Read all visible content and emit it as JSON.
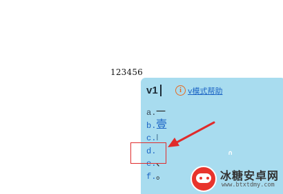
{
  "document": {
    "typed_text": "123456"
  },
  "ime": {
    "input_code": "v1",
    "help_icon_glyph": "i",
    "help_link": "v模式帮助",
    "candidates": [
      {
        "key": "a.",
        "text": "一",
        "state": "normal"
      },
      {
        "key": "b.",
        "text": "壹",
        "state": "active"
      },
      {
        "key": "c.",
        "text": "Ⅰ",
        "state": "faded"
      },
      {
        "key": "d.",
        "text": "",
        "state": "highlighted"
      },
      {
        "key": "e.",
        "text": "、",
        "state": "active"
      },
      {
        "key": "f.",
        "text": "。",
        "state": "active"
      }
    ],
    "panel_color": "#a8dcef",
    "link_color": "#1a63c4",
    "help_icon_color": "#e8671c"
  },
  "annotation": {
    "arrow_color": "#e02b2b",
    "box_color": "#e02b2b"
  },
  "watermark": {
    "title": "冰糖安卓网",
    "url": "www.btxtdmy.com",
    "logo_color": "#e8342c"
  }
}
